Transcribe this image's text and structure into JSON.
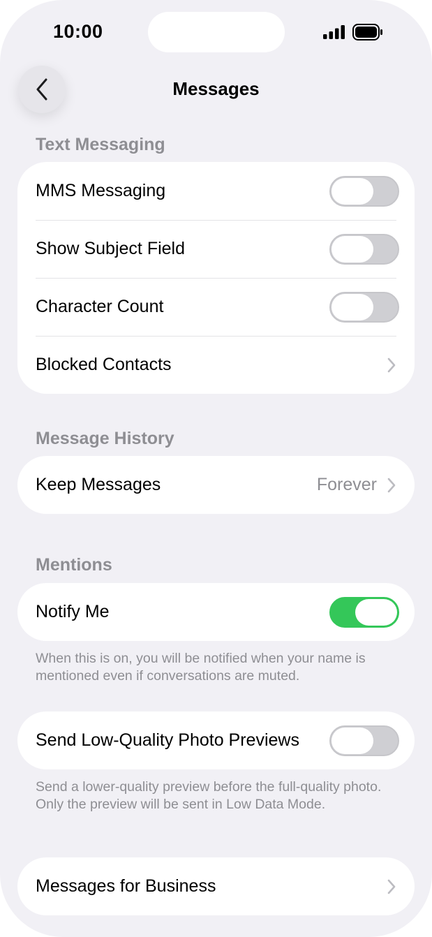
{
  "status_bar": {
    "time": "10:00",
    "signal_icon": "cellular-signal-icon",
    "battery_icon": "battery-icon"
  },
  "nav": {
    "back_icon": "chevron-left-icon",
    "title": "Messages"
  },
  "text_messaging": {
    "header": "Text Messaging",
    "rows": [
      {
        "label": "MMS Messaging",
        "control": "toggle",
        "on": false
      },
      {
        "label": "Show Subject Field",
        "control": "toggle",
        "on": false
      },
      {
        "label": "Character Count",
        "control": "toggle",
        "on": false
      },
      {
        "label": "Blocked Contacts",
        "control": "chevron"
      }
    ]
  },
  "message_history": {
    "header": "Message History",
    "rows": [
      {
        "label": "Keep Messages",
        "value": "Forever",
        "control": "chevron"
      }
    ]
  },
  "mentions": {
    "header": "Mentions",
    "rows": [
      {
        "label": "Notify Me",
        "control": "toggle",
        "on": true
      }
    ],
    "footer": "When this is on, you will be notified when your name is mentioned even if conversations are muted."
  },
  "photo_previews": {
    "rows": [
      {
        "label": "Send Low-Quality Photo Previews",
        "control": "toggle",
        "on": false
      }
    ],
    "footer": "Send a lower-quality preview before the full-quality photo. Only the preview will be sent in Low Data Mode."
  },
  "business": {
    "rows": [
      {
        "label": "Messages for Business",
        "control": "chevron"
      }
    ]
  },
  "colors": {
    "background": "#f1f0f5",
    "toggle_on": "#34c759",
    "toggle_off": "#cfcfd3",
    "secondary_text": "#8e8e93"
  }
}
